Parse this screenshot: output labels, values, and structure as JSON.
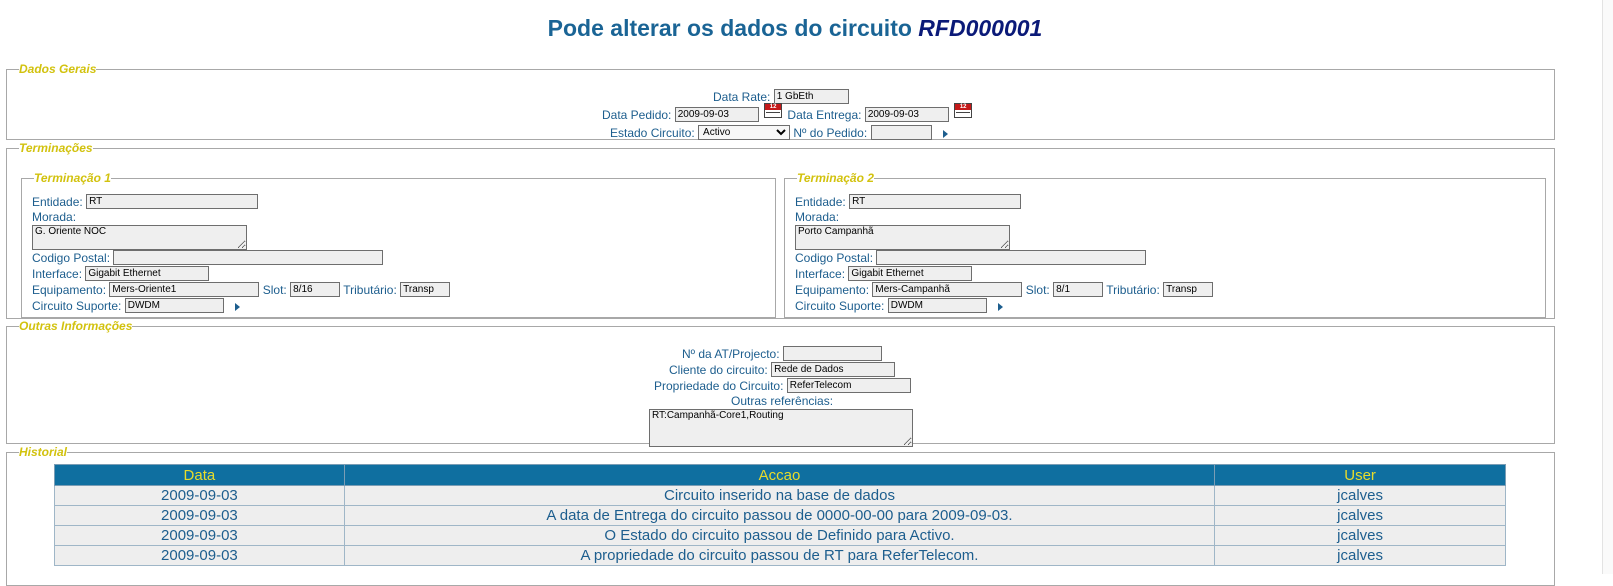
{
  "page": {
    "title": "Pode alterar os dados do circuito",
    "circuit_code": "RFD000001"
  },
  "dados_gerais": {
    "legend": "Dados Gerais",
    "data_rate_label": "Data Rate:",
    "data_rate_value": "1 GbEth",
    "data_pedido_label": "Data Pedido:",
    "data_pedido_value": "2009-09-03",
    "data_entrega_label": "Data Entrega:",
    "data_entrega_value": "2009-09-03",
    "estado_label": "Estado Circuito:",
    "estado_value": "Activo",
    "pedido_label": "Nº do Pedido:",
    "pedido_value": "",
    "calendar_icon_text": "12"
  },
  "terminacoes": {
    "legend": "Terminações",
    "t1": {
      "legend": "Terminação 1",
      "entidade_label": "Entidade:",
      "entidade_value": "RT",
      "morada_label": "Morada:",
      "morada_value": "G. Oriente NOC",
      "codigo_postal_label": "Codigo Postal:",
      "codigo_postal_value": "",
      "interface_label": "Interface:",
      "interface_value": "Gigabit Ethernet",
      "equipamento_label": "Equipamento:",
      "equipamento_value": "Mers-Oriente1",
      "slot_label": "Slot:",
      "slot_value": "8/16",
      "tributario_label": "Tributário:",
      "tributario_value": "Transp",
      "circuito_suporte_label": "Circuito Suporte:",
      "circuito_suporte_value": "DWDM"
    },
    "t2": {
      "legend": "Terminação 2",
      "entidade_label": "Entidade:",
      "entidade_value": "RT",
      "morada_label": "Morada:",
      "morada_value": "Porto Campanhã",
      "codigo_postal_label": "Codigo Postal:",
      "codigo_postal_value": "",
      "interface_label": "Interface:",
      "interface_value": "Gigabit Ethernet",
      "equipamento_label": "Equipamento:",
      "equipamento_value": "Mers-Campanhã",
      "slot_label": "Slot:",
      "slot_value": "8/1",
      "tributario_label": "Tributário:",
      "tributario_value": "Transp",
      "circuito_suporte_label": "Circuito Suporte:",
      "circuito_suporte_value": "DWDM"
    }
  },
  "outras": {
    "legend": "Outras Informações",
    "at_label": "Nº da AT/Projecto:",
    "at_value": "",
    "cliente_label": "Cliente do circuito:",
    "cliente_value": "Rede de Dados",
    "propriedade_label": "Propriedade do Circuito:",
    "propriedade_value": "ReferTelecom",
    "outras_ref_label": "Outras referências:",
    "outras_ref_value": "RT:Campanhã-Core1,Routing"
  },
  "historial": {
    "legend": "Historial",
    "headers": {
      "data": "Data",
      "accao": "Accao",
      "user": "User"
    },
    "rows": [
      {
        "data": "2009-09-03",
        "accao": "Circuito inserido na base de dados",
        "user": "jcalves"
      },
      {
        "data": "2009-09-03",
        "accao": "A data de Entrega do circuito passou de 0000-00-00 para 2009-09-03.",
        "user": "jcalves"
      },
      {
        "data": "2009-09-03",
        "accao": "O Estado do circuito passou de Definido para Activo.",
        "user": "jcalves"
      },
      {
        "data": "2009-09-03",
        "accao": "A propriedade do circuito passou de RT para ReferTelecom.",
        "user": "jcalves"
      }
    ]
  }
}
